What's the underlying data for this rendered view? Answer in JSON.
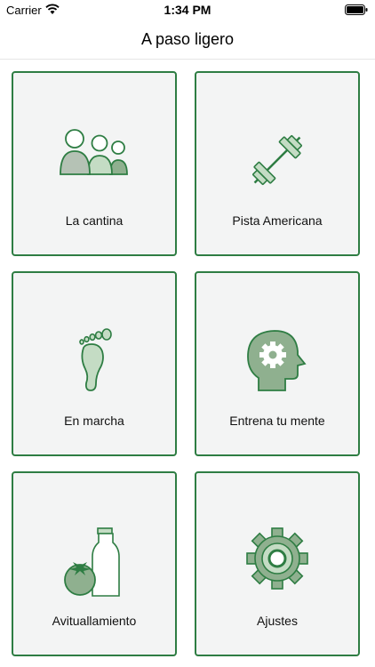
{
  "status_bar": {
    "carrier": "Carrier",
    "time": "1:34 PM"
  },
  "nav": {
    "title": "A paso ligero"
  },
  "tiles": [
    {
      "label": "La cantina",
      "icon": "people-icon"
    },
    {
      "label": "Pista Americana",
      "icon": "dumbbell-icon"
    },
    {
      "label": "En marcha",
      "icon": "footprint-icon"
    },
    {
      "label": "Entrena tu mente",
      "icon": "head-gear-icon"
    },
    {
      "label": "Avituallamiento",
      "icon": "tomato-milk-icon"
    },
    {
      "label": "Ajustes",
      "icon": "gear-icon"
    }
  ],
  "colors": {
    "accent": "#2e7d43",
    "icon_fill": "#8fb08f",
    "icon_light": "#c4dcc4",
    "tile_bg": "#f3f4f4"
  }
}
